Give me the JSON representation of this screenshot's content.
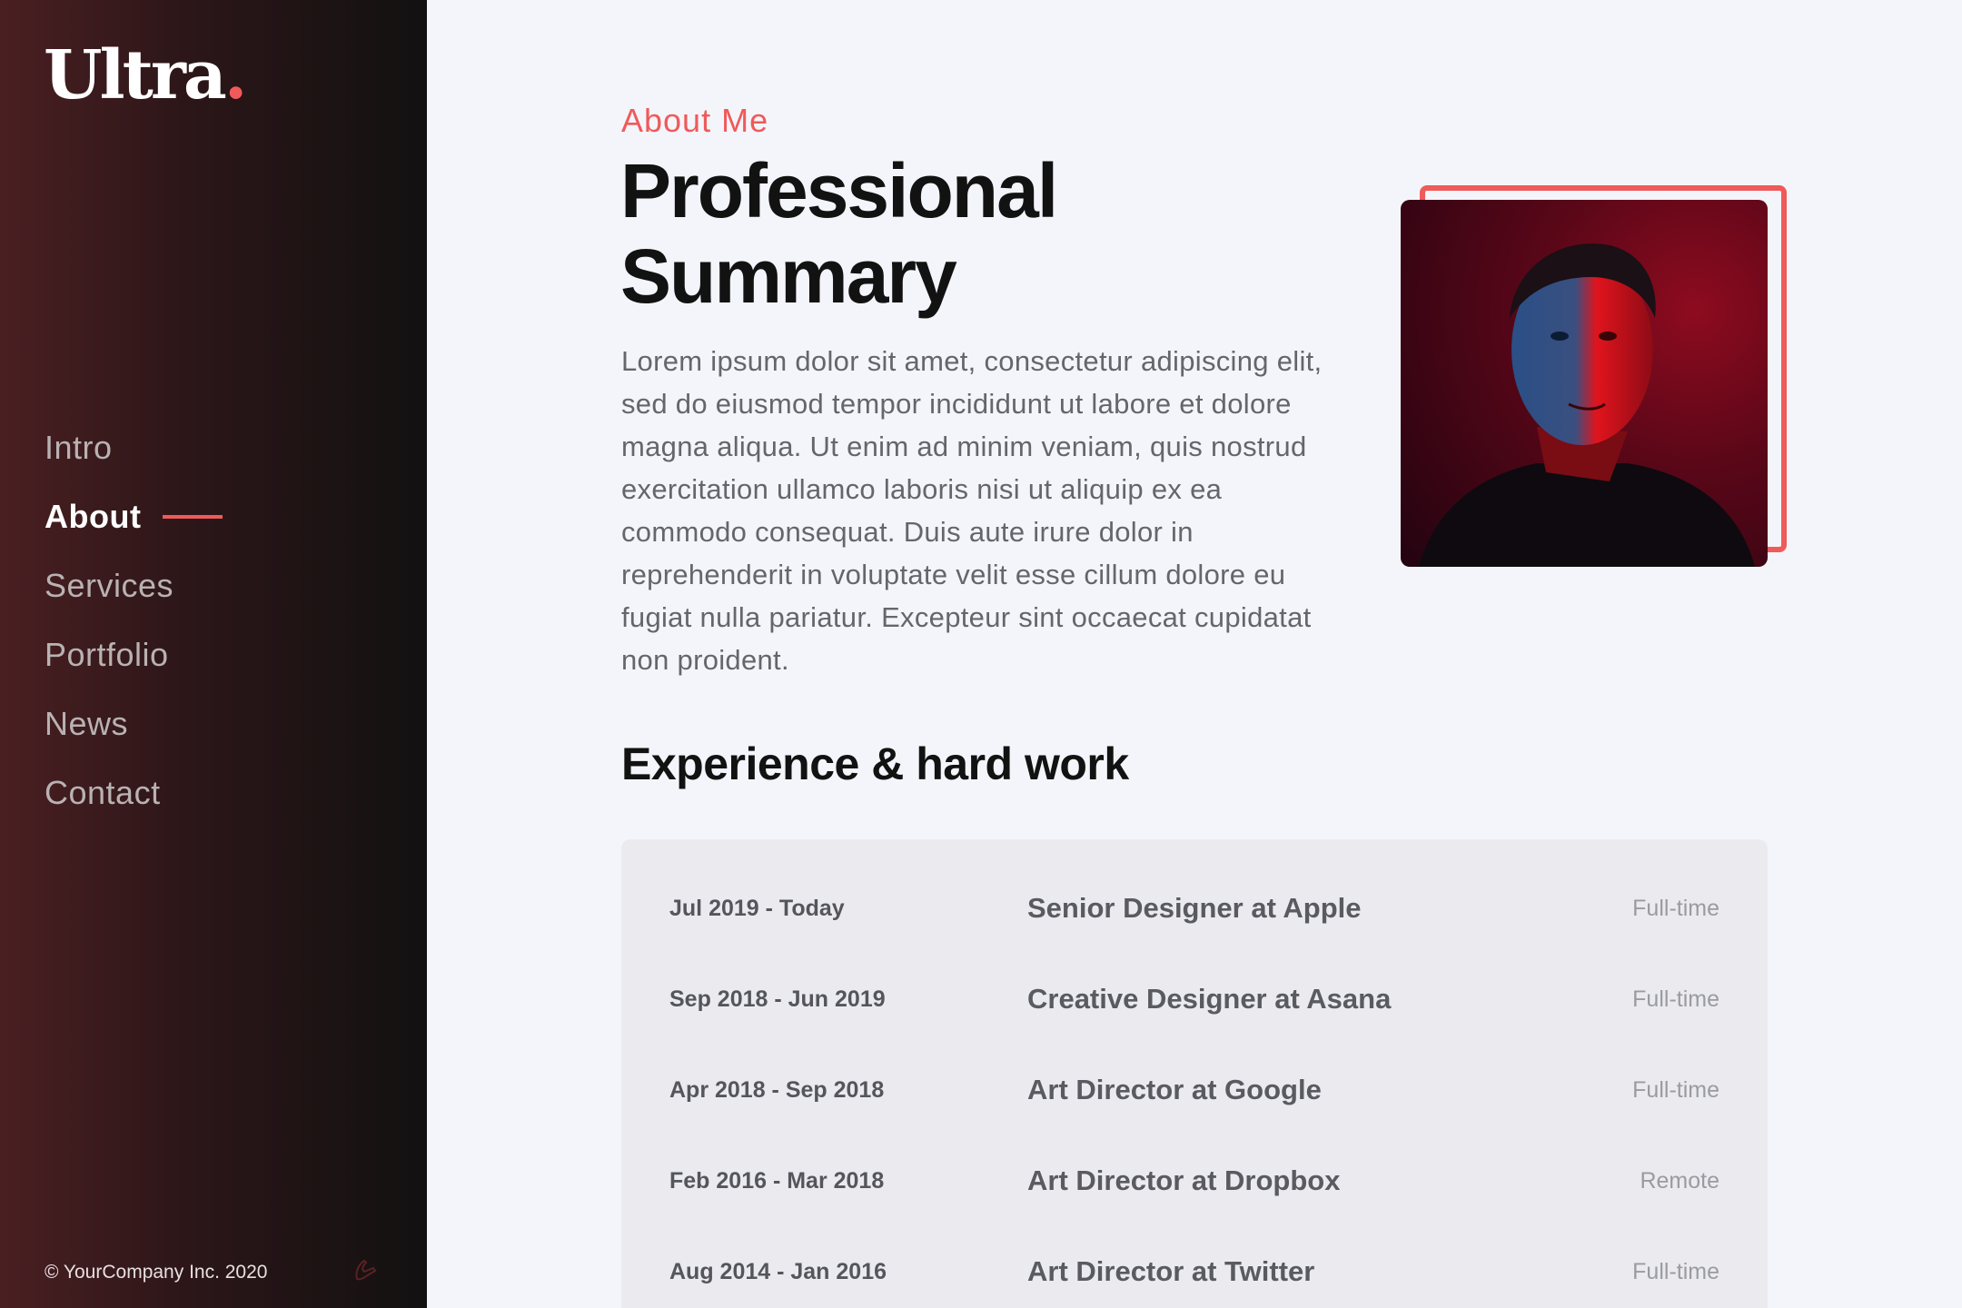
{
  "brand": {
    "name": "Ultra",
    "dot": ".",
    "accent": "#ef5a5a"
  },
  "nav": {
    "items": [
      {
        "label": "Intro"
      },
      {
        "label": "About"
      },
      {
        "label": "Services"
      },
      {
        "label": "Portfolio"
      },
      {
        "label": "News"
      },
      {
        "label": "Contact"
      }
    ],
    "active": "About"
  },
  "footer": {
    "copyright": "© YourCompany Inc. 2020"
  },
  "about": {
    "eyebrow": "About Me",
    "title_line1": "Professional",
    "title_line2": "Summary",
    "body": "Lorem ipsum dolor sit amet, consectetur adipiscing elit, sed do eiusmod tempor incididunt ut labore et dolore magna aliqua. Ut enim ad minim veniam, quis nostrud exercitation ullamco laboris nisi ut aliquip ex ea commodo consequat. Duis aute irure dolor in reprehenderit in voluptate velit esse cillum dolore eu fugiat nulla pariatur. Excepteur sint occaecat cupidatat non proident."
  },
  "experience": {
    "heading": "Experience & hard work",
    "rows": [
      {
        "date": "Jul 2019 - Today",
        "role": "Senior Designer at Apple",
        "type": "Full-time"
      },
      {
        "date": "Sep 2018 - Jun 2019",
        "role": "Creative Designer at Asana",
        "type": "Full-time"
      },
      {
        "date": "Apr 2018 - Sep 2018",
        "role": "Art Director at Google",
        "type": "Full-time"
      },
      {
        "date": "Feb 2016 - Mar 2018",
        "role": "Art Director at Dropbox",
        "type": "Remote"
      },
      {
        "date": "Aug 2014 - Jan 2016",
        "role": "Art Director at Twitter",
        "type": "Full-time"
      }
    ]
  }
}
